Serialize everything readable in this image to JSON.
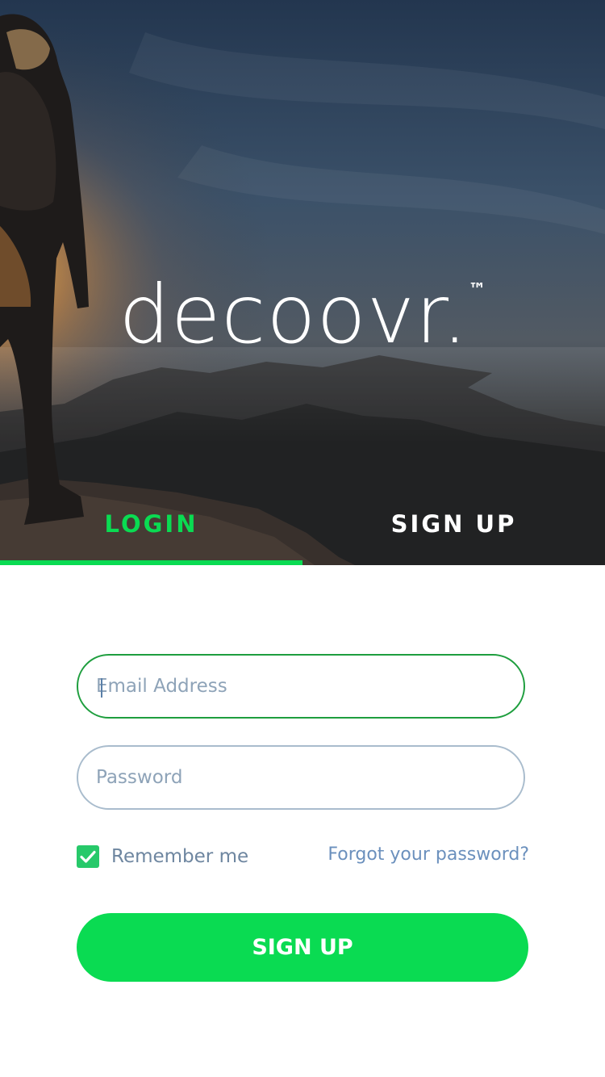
{
  "brand": {
    "name": "decoovr.",
    "trademark": "™"
  },
  "tabs": [
    {
      "label": "LOGIN",
      "active": true
    },
    {
      "label": "SIGN UP",
      "active": false
    }
  ],
  "form": {
    "email": {
      "placeholder": "Email Address",
      "value": ""
    },
    "password": {
      "placeholder": "Password",
      "value": ""
    },
    "remember": {
      "label": "Remember me",
      "checked": true
    },
    "forgot_label": "Forgot your password?",
    "submit_label": "SIGN UP"
  },
  "colors": {
    "accent": "#0adb52",
    "field_focus_border": "#1e9e3e",
    "field_border": "#a9bccd",
    "link": "#6b90bd",
    "muted_text": "#6e86a0"
  },
  "icons": {
    "checkbox": "check-icon"
  }
}
